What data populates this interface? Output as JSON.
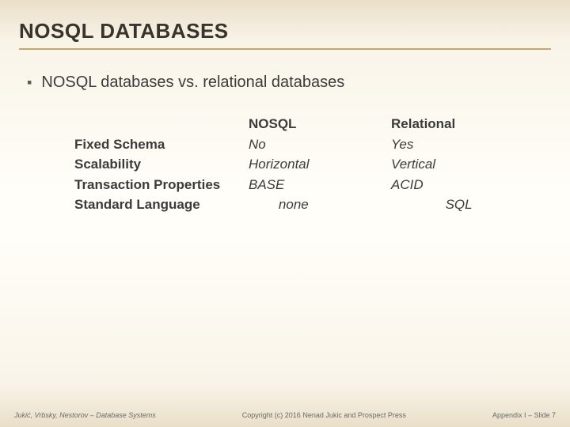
{
  "title": "NOSQL DATABASES",
  "bullet": "NOSQL databases vs. relational databases",
  "table": {
    "header": {
      "label": "",
      "nosql": "NOSQL",
      "rel": "Relational"
    },
    "rows": [
      {
        "label": "Fixed Schema",
        "nosql": "No",
        "rel": "Yes"
      },
      {
        "label": "Scalability",
        "nosql": "Horizontal",
        "rel": "Vertical"
      },
      {
        "label": "Transaction Properties",
        "nosql": "BASE",
        "rel": "ACID"
      },
      {
        "label": "Standard Language",
        "nosql": "none",
        "rel": "SQL"
      }
    ]
  },
  "footer": {
    "left": "Jukić, Vrbsky, Nestorov – Database Systems",
    "center": "Copyright (c) 2016 Nenad Jukic and Prospect Press",
    "right": "Appendix I – Slide 7"
  }
}
